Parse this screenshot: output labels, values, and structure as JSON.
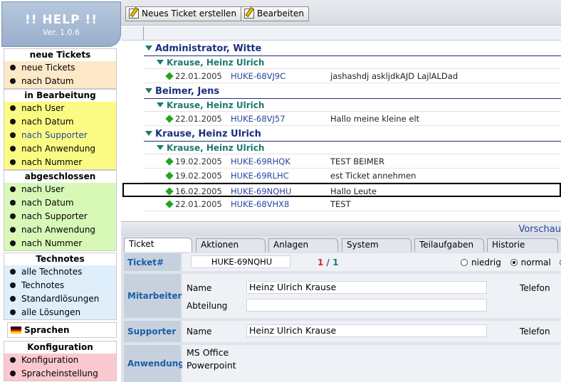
{
  "logo": {
    "title": "!! HELP !!",
    "version": "Ver. 1.0.6"
  },
  "sidebar": {
    "neue_tickets": {
      "header": "neue Tickets",
      "items": [
        "neue Tickets",
        "nach Datum"
      ]
    },
    "in_bearbeitung": {
      "header": "in Bearbeitung",
      "items": [
        "nach User",
        "nach Datum",
        "nach Supporter",
        "nach Anwendung",
        "nach Nummer"
      ]
    },
    "abgeschlossen": {
      "header": "abgeschlossen",
      "items": [
        "nach User",
        "nach Datum",
        "nach Supporter",
        "nach Anwendung",
        "nach Nummer"
      ]
    },
    "technotes": {
      "header": "Technotes",
      "items": [
        "alle Technotes",
        "Technotes",
        "Standardlösungen",
        "alle Lösungen"
      ]
    },
    "sprachen": "Sprachen",
    "konfiguration": {
      "header": "Konfiguration",
      "items": [
        "Konfiguration",
        "Spracheinstellung"
      ]
    }
  },
  "toolbar": {
    "new_ticket": "Neues Ticket erstellen",
    "edit": "Bearbeiten"
  },
  "tickets": {
    "groups": [
      {
        "supporter": "Administrator, Witte",
        "user": "Krause, Heinz Ulrich",
        "rows": [
          {
            "date": "22.01.2005",
            "number": "HUKE-68VJ9C",
            "subject": "jashashdj askljdkAJD  LajlALDad"
          }
        ]
      },
      {
        "supporter": "Beimer, Jens",
        "user": "Krause, Heinz Ulrich",
        "rows": [
          {
            "date": "22.01.2005",
            "number": "HUKE-68VJ57",
            "subject": "Hallo meine kleine elt"
          }
        ]
      },
      {
        "supporter": "Krause, Heinz Ulrich",
        "user": "Krause, Heinz Ulrich",
        "rows": [
          {
            "date": "19.02.2005",
            "number": "HUKE-69RHQK",
            "subject": "TEST BEIMER"
          },
          {
            "date": "19.02.2005",
            "number": "HUKE-69RLHC",
            "subject": "est Ticket annehmen"
          },
          {
            "date": "16.02.2005",
            "number": "HUKE-69NQHU",
            "subject": "Hallo Leute"
          },
          {
            "date": "22.01.2005",
            "number": "HUKE-68VHX8",
            "subject": "TEST"
          }
        ]
      }
    ]
  },
  "preview": {
    "header": "Vorschau",
    "tabs": [
      "Ticket",
      "Aktionen",
      "Anlagen",
      "System",
      "Teilaufgaben",
      "Historie"
    ],
    "ticket_label": "Ticket#",
    "ticket_number": "HUKE-69NQHU",
    "page_current": "1",
    "page_sep": "/",
    "page_total": "1",
    "priority_low": "niedrig",
    "priority_normal": "normal",
    "mitarbeiter_label": "Mitarbeiter",
    "name_label": "Name",
    "mitarbeiter_name": "Heinz Ulrich Krause",
    "abteilung_label": "Abteilung",
    "abteilung_value": "",
    "telefon_label": "Telefon",
    "supporter_label": "Supporter",
    "supporter_name": "Heinz Ulrich Krause",
    "anwendung_label": "Anwendung",
    "anwendung_lines": [
      "MS Office",
      "Powerpoint"
    ]
  },
  "colors": {
    "accent": "#1b2f7d",
    "user_group": "#1c7a6c",
    "link": "#2745a0",
    "label": "#1b5ea8"
  }
}
